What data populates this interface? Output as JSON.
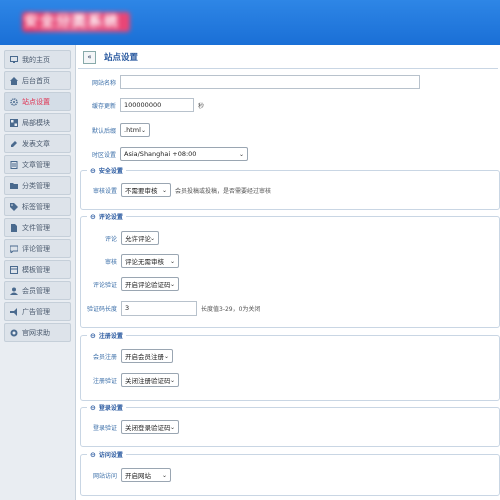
{
  "header": {
    "logo_text": "安全分类系统"
  },
  "sidebar": {
    "items": [
      {
        "label": "我的主页",
        "icon": "monitor-icon",
        "active": false
      },
      {
        "label": "后台首页",
        "icon": "home-icon",
        "active": false
      },
      {
        "label": "站点设置",
        "icon": "gear-icon",
        "active": true
      },
      {
        "label": "局部模块",
        "icon": "grid-icon",
        "active": false
      },
      {
        "label": "发表文章",
        "icon": "edit-icon",
        "active": false
      },
      {
        "label": "文章管理",
        "icon": "document-icon",
        "active": false
      },
      {
        "label": "分类管理",
        "icon": "folder-icon",
        "active": false
      },
      {
        "label": "标签管理",
        "icon": "tag-icon",
        "active": false
      },
      {
        "label": "文件管理",
        "icon": "file-icon",
        "active": false
      },
      {
        "label": "评论管理",
        "icon": "comment-icon",
        "active": false
      },
      {
        "label": "模板管理",
        "icon": "template-icon",
        "active": false
      },
      {
        "label": "会员管理",
        "icon": "users-icon",
        "active": false
      },
      {
        "label": "广告管理",
        "icon": "ad-icon",
        "active": false
      },
      {
        "label": "官网求助",
        "icon": "help-icon",
        "active": false
      }
    ]
  },
  "main": {
    "collapse_label": "«",
    "title": "站点设置",
    "fields": {
      "site_name": {
        "label": "网站名称",
        "value": ""
      },
      "cache": {
        "label": "缓存更新",
        "value": "100000000",
        "unit": "秒"
      },
      "suffix": {
        "label": "默认后缀",
        "value": ".html"
      },
      "timezone": {
        "label": "时区设置",
        "value": "Asia/Shanghai +08:00"
      }
    },
    "sections": {
      "security": {
        "title": "安全设置",
        "audit": {
          "label": "审核设置",
          "value": "不需要审核",
          "hint": "会员投稿或投稿，是否需要经过审核"
        }
      },
      "comment": {
        "title": "评论设置",
        "comment": {
          "label": "评论",
          "value": "允许评论"
        },
        "audit": {
          "label": "审核",
          "value": "评论无需审核"
        },
        "captcha": {
          "label": "评论验证",
          "value": "开启评论验证码"
        },
        "length": {
          "label": "验证码长度",
          "value": "3",
          "hint": "长度值3-29，0为关闭"
        }
      },
      "register": {
        "title": "注册设置",
        "member": {
          "label": "会员注册",
          "value": "开启会员注册"
        },
        "captcha": {
          "label": "注册验证",
          "value": "关闭注册验证码"
        }
      },
      "login": {
        "title": "登录设置",
        "captcha": {
          "label": "登录验证",
          "value": "关闭登录验证码"
        }
      },
      "access": {
        "title": "访问设置",
        "permission": {
          "label": "网站访问",
          "value": "开启网站"
        }
      }
    }
  },
  "colors": {
    "topbar": "#1a6fd6",
    "accent": "#2a5aa0",
    "active_text": "#e03050"
  }
}
